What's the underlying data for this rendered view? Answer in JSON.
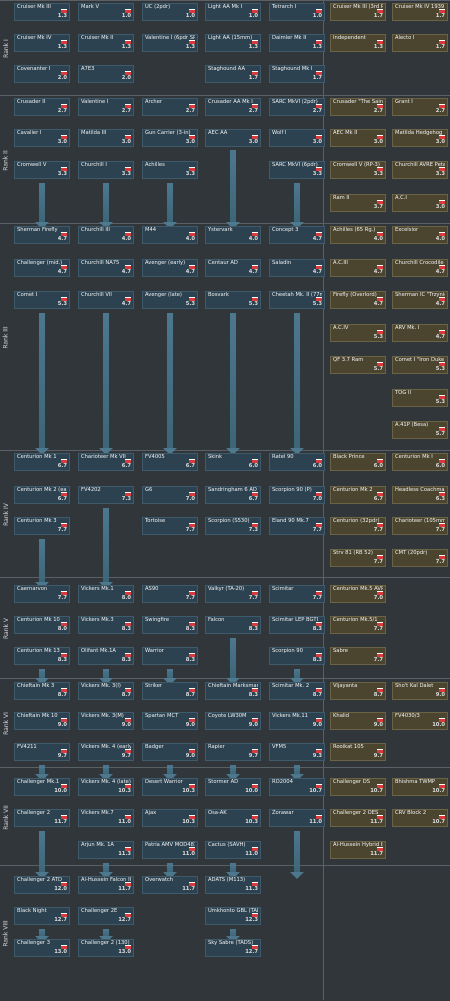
{
  "ranks": [
    {
      "label": "Rank I"
    },
    {
      "label": "Rank II"
    },
    {
      "label": "Rank III"
    },
    {
      "label": "Rank IV"
    },
    {
      "label": "Rank V"
    },
    {
      "label": "Rank VI"
    },
    {
      "label": "Rank VII"
    },
    {
      "label": "Rank VIII"
    }
  ],
  "vehicles": [
    {
      "id": "r1a",
      "name": "Cruiser Mk III",
      "br": "1.3"
    },
    {
      "id": "r1b",
      "name": "Mark V",
      "br": "1.0"
    },
    {
      "id": "r1c",
      "name": "UC (2pdr)",
      "br": "1.0"
    },
    {
      "id": "r1d",
      "name": "Light AA Mk I",
      "br": "1.0"
    },
    {
      "id": "r1e",
      "name": "Tetrarch I",
      "br": "1.0"
    },
    {
      "id": "r1f",
      "name": "Cruiser Mk III (3rd R.T.R.)",
      "br": "1.7",
      "premium": true
    },
    {
      "id": "r1g",
      "name": "Cruiser Mk IV 1939",
      "br": "1.7",
      "premium": true
    },
    {
      "id": "r1h",
      "name": "Cruiser Mk IV",
      "br": "1.3"
    },
    {
      "id": "r1i",
      "name": "Cruiser Mk II",
      "br": "1.3"
    },
    {
      "id": "r1j",
      "name": "Valentine I (6pdr SP)",
      "br": "1.3"
    },
    {
      "id": "r1k",
      "name": "Light AA (15mm)",
      "br": "1.3"
    },
    {
      "id": "r1l",
      "name": "Daimler Mk II",
      "br": "1.3"
    },
    {
      "id": "r1m",
      "name": "Independent",
      "br": "1.3",
      "premium": true
    },
    {
      "id": "r1n",
      "name": "Alecto I",
      "br": "1.7",
      "premium": true
    },
    {
      "id": "r1o",
      "name": "Covenanter I",
      "br": "2.0"
    },
    {
      "id": "r1p",
      "name": "A7E3",
      "br": "2.0"
    },
    {
      "id": "r1q",
      "name": "Staghound AA",
      "br": "1.7"
    },
    {
      "id": "r1r",
      "name": "Staghound Mk I",
      "br": "1.7"
    },
    {
      "id": "r2a",
      "name": "Crusader II",
      "br": "2.7"
    },
    {
      "id": "r2b",
      "name": "Valentine I",
      "br": "2.7"
    },
    {
      "id": "r2c",
      "name": "Archer",
      "br": "2.7"
    },
    {
      "id": "r2d",
      "name": "Crusader AA Mk I",
      "br": "2.7"
    },
    {
      "id": "r2e",
      "name": "SARC MkVI (2pdr)",
      "br": "2.7"
    },
    {
      "id": "r2f",
      "name": "Crusader \"The Saint\"",
      "br": "2.7",
      "premium": true
    },
    {
      "id": "r2g",
      "name": "Grant I",
      "br": "2.7",
      "premium": true
    },
    {
      "id": "r2h",
      "name": "Cavalier I",
      "br": "3.0"
    },
    {
      "id": "r2i",
      "name": "Matilda III",
      "br": "3.0"
    },
    {
      "id": "r2j",
      "name": "Gun Carrier (3-in)",
      "br": "3.0"
    },
    {
      "id": "r2k",
      "name": "AEC AA",
      "br": "3.0"
    },
    {
      "id": "r2l",
      "name": "Wolf I",
      "br": "3.0"
    },
    {
      "id": "r2m",
      "name": "AEC Mk II",
      "br": "3.0",
      "premium": true
    },
    {
      "id": "r2n",
      "name": "Matilda Hedgehog",
      "br": "3.0",
      "premium": true
    },
    {
      "id": "r2o",
      "name": "Cromwell V",
      "br": "3.3"
    },
    {
      "id": "r2p",
      "name": "Churchill I",
      "br": "3.3"
    },
    {
      "id": "r2q",
      "name": "Achilles",
      "br": "3.3"
    },
    {
      "id": "r2r",
      "name": "SARC MkVI (6pdr)",
      "br": "3.3"
    },
    {
      "id": "r2s",
      "name": "Cromwell V (RP-3)",
      "br": "3.3",
      "premium": true
    },
    {
      "id": "r2t",
      "name": "Churchill AVRE Petard",
      "br": "3.3",
      "premium": true
    },
    {
      "id": "r2u",
      "name": "Ram II",
      "br": "3.7",
      "premium": true
    },
    {
      "id": "r2v",
      "name": "A.C.I",
      "br": "3.0",
      "premium": true
    },
    {
      "id": "r3a",
      "name": "Sherman Firefly",
      "br": "4.7"
    },
    {
      "id": "r3b",
      "name": "Churchill III",
      "br": "4.0"
    },
    {
      "id": "r3c",
      "name": "M44",
      "br": "4.0"
    },
    {
      "id": "r3d",
      "name": "Ystervark",
      "br": "4.0"
    },
    {
      "id": "r3e",
      "name": "Concept 3",
      "br": "4.7"
    },
    {
      "id": "r3f",
      "name": "Achilles (65 Rg.)",
      "br": "4.0",
      "premium": true
    },
    {
      "id": "r3g",
      "name": "Excelsior",
      "br": "4.0",
      "premium": true
    },
    {
      "id": "r3h",
      "name": "Challenger (mid.)",
      "br": "4.7"
    },
    {
      "id": "r3i",
      "name": "Churchill NA75",
      "br": "4.7"
    },
    {
      "id": "r3j",
      "name": "Avenger (early)",
      "br": "4.7"
    },
    {
      "id": "r3k",
      "name": "Centaur AD",
      "br": "4.7"
    },
    {
      "id": "r3l",
      "name": "Saladin",
      "br": "4.7"
    },
    {
      "id": "r3m",
      "name": "A.C.III",
      "br": "4.7",
      "premium": true
    },
    {
      "id": "r3n",
      "name": "Churchill Crocodile",
      "br": "4.7",
      "premium": true
    },
    {
      "id": "r3o",
      "name": "Comet I",
      "br": "5.3"
    },
    {
      "id": "r3p",
      "name": "Churchill VII",
      "br": "4.7"
    },
    {
      "id": "r3q",
      "name": "Avenger (late)",
      "br": "5.3"
    },
    {
      "id": "r3r",
      "name": "Bosvark",
      "br": "5.3"
    },
    {
      "id": "r3s",
      "name": "Cheetah Mk. II (77mm)",
      "br": "5.3"
    },
    {
      "id": "r3t",
      "name": "Firefly (Overlord)",
      "br": "4.7",
      "premium": true
    },
    {
      "id": "r3u",
      "name": "Sherman IC \"Trzyniec\"",
      "br": "4.7",
      "premium": true
    },
    {
      "id": "r3v",
      "name": "A.C.IV",
      "br": "5.3",
      "premium": true
    },
    {
      "id": "r3w",
      "name": "ARV Mk. I",
      "br": "4.7",
      "premium": true
    },
    {
      "id": "r3x",
      "name": "QF 3.7 Ram",
      "br": "5.7",
      "premium": true
    },
    {
      "id": "r3y",
      "name": "Comet I \"Iron Duke IV\"",
      "br": "5.3",
      "premium": true
    },
    {
      "id": "r3z",
      "name": "TOG II",
      "br": "5.3",
      "premium": true
    },
    {
      "id": "r3za",
      "name": "A.41P (Besa)",
      "br": "5.7",
      "premium": true
    },
    {
      "id": "r4a",
      "name": "Centurion Mk 1",
      "br": "6.7"
    },
    {
      "id": "r4b",
      "name": "Charioteer Mk VII",
      "br": "6.7"
    },
    {
      "id": "r4c",
      "name": "FV4005",
      "br": "6.7"
    },
    {
      "id": "r4d",
      "name": "Skink",
      "br": "6.0"
    },
    {
      "id": "r4e",
      "name": "Ratel 90",
      "br": "6.0"
    },
    {
      "id": "r4f",
      "name": "Black Prince",
      "br": "6.0",
      "premium": true
    },
    {
      "id": "r4g",
      "name": "Centurion Mk I",
      "br": "6.0",
      "premium": true
    },
    {
      "id": "r4h",
      "name": "Centurion Mk 2 (early)",
      "br": "6.7"
    },
    {
      "id": "r4i",
      "name": "FV4202",
      "br": "7.3"
    },
    {
      "id": "r4j",
      "name": "G6",
      "br": "7.0"
    },
    {
      "id": "r4k",
      "name": "Sandringham 6 AD",
      "br": "6.7"
    },
    {
      "id": "r4l",
      "name": "Scorpion 90 (P)",
      "br": "7.0"
    },
    {
      "id": "r4m",
      "name": "Centurion Mk 2",
      "br": "6.7",
      "premium": true
    },
    {
      "id": "r4n",
      "name": "Headless Coachman",
      "br": "6.3",
      "premium": true
    },
    {
      "id": "r4o",
      "name": "Centurion Mk 3",
      "br": "7.7"
    },
    {
      "id": "r4p",
      "name": "Tortoise",
      "br": "7.7"
    },
    {
      "id": "r4q",
      "name": "Scorpion (S530)",
      "br": "7.3"
    },
    {
      "id": "r4r",
      "name": "Eland 90 Mk.7",
      "br": "7.7"
    },
    {
      "id": "r4s",
      "name": "Centurion (32pdr)",
      "br": "7.7",
      "premium": true
    },
    {
      "id": "r4t",
      "name": "Charioteer (105mm)",
      "br": "7.7",
      "premium": true
    },
    {
      "id": "r4u",
      "name": "Strv 81 (RB 52)",
      "br": "7.7",
      "premium": true
    },
    {
      "id": "r4v",
      "name": "CMT (20pdr)",
      "br": "7.7",
      "premium": true
    },
    {
      "id": "r5a",
      "name": "Caernarvon",
      "br": "7.7"
    },
    {
      "id": "r5b",
      "name": "Vickers Mk.1",
      "br": "8.0"
    },
    {
      "id": "r5c",
      "name": "AS90",
      "br": "7.7"
    },
    {
      "id": "r5d",
      "name": "Valkyr (TA-20)",
      "br": "7.7"
    },
    {
      "id": "r5e",
      "name": "Scimitar",
      "br": "7.7"
    },
    {
      "id": "r5f",
      "name": "Centurion Mk.5 AVRE",
      "br": "7.0",
      "premium": true
    },
    {
      "id": "r5g",
      "name": "Centurion Mk 10",
      "br": "8.0"
    },
    {
      "id": "r5h",
      "name": "Vickers Mk.3",
      "br": "8.3"
    },
    {
      "id": "r5i",
      "name": "Swingfire",
      "br": "8.3"
    },
    {
      "id": "r5j",
      "name": "Falcon",
      "br": "8.3"
    },
    {
      "id": "r5k",
      "name": "Scimitar LEP BGTI",
      "br": "8.3"
    },
    {
      "id": "r5l",
      "name": "Centurion Mk.5/1",
      "br": "7.7",
      "premium": true
    },
    {
      "id": "r5m",
      "name": "Centurion Mk 13",
      "br": "8.3"
    },
    {
      "id": "r5n",
      "name": "Olifant Mk.1A",
      "br": "8.3"
    },
    {
      "id": "r5o",
      "name": "Warrior",
      "br": "8.3"
    },
    {
      "id": "r5p",
      "name": "Scorpion 90",
      "br": "8.3"
    },
    {
      "id": "r5q",
      "name": "Sabre",
      "br": "7.7",
      "premium": true
    },
    {
      "id": "r6a",
      "name": "Chieftain Mk 3",
      "br": "8.7"
    },
    {
      "id": "r6b",
      "name": "Vickers Mk. 3(I)",
      "br": "8.7"
    },
    {
      "id": "r6c",
      "name": "Striker",
      "br": "8.7"
    },
    {
      "id": "r6d",
      "name": "Chieftain Marksman",
      "br": "8.3"
    },
    {
      "id": "r6e",
      "name": "Scimitar Mk. 2",
      "br": "8.7"
    },
    {
      "id": "r6f",
      "name": "Vijayanta",
      "br": "8.7",
      "premium": true
    },
    {
      "id": "r6g",
      "name": "Sho't Kal Dalet",
      "br": "9.0",
      "premium": true
    },
    {
      "id": "r6h",
      "name": "Chieftain Mk 10",
      "br": "9.0"
    },
    {
      "id": "r6i",
      "name": "Vickers Mk. 3(M)",
      "br": "9.0"
    },
    {
      "id": "r6j",
      "name": "Spartan MCT",
      "br": "9.0"
    },
    {
      "id": "r6k",
      "name": "Coyote LW30M",
      "br": "9.0"
    },
    {
      "id": "r6l",
      "name": "Vickers Mk.11",
      "br": "9.0"
    },
    {
      "id": "r6m",
      "name": "Khalid",
      "br": "9.0",
      "premium": true
    },
    {
      "id": "r6n",
      "name": "FV4030/3",
      "br": "10.0",
      "premium": true
    },
    {
      "id": "r6o",
      "name": "FV4211",
      "br": "9.7"
    },
    {
      "id": "r6p",
      "name": "Vickers Mk. 4 (early)",
      "br": "9.7"
    },
    {
      "id": "r6q",
      "name": "Badger",
      "br": "9.0"
    },
    {
      "id": "r6r",
      "name": "Rapier",
      "br": "9.7"
    },
    {
      "id": "r6s",
      "name": "VFM5",
      "br": "9.3"
    },
    {
      "id": "r6t",
      "name": "Rooikat 105",
      "br": "9.7",
      "premium": true
    },
    {
      "id": "r7a",
      "name": "Challenger Mk.1",
      "br": "10.0"
    },
    {
      "id": "r7b",
      "name": "Vickers Mk. 4 (late)",
      "br": "10.3"
    },
    {
      "id": "r7c",
      "name": "Desert Warrior",
      "br": "10.3"
    },
    {
      "id": "r7d",
      "name": "Stormer AD",
      "br": "10.0"
    },
    {
      "id": "r7e",
      "name": "RO2004",
      "br": "10.7"
    },
    {
      "id": "r7f",
      "name": "Challenger DS",
      "br": "10.7",
      "premium": true
    },
    {
      "id": "r7g",
      "name": "Bhishma TWMP",
      "br": "10.7",
      "premium": true
    },
    {
      "id": "r7h",
      "name": "Challenger 2",
      "br": "11.7"
    },
    {
      "id": "r7i",
      "name": "Vickers Mk.7",
      "br": "11.0"
    },
    {
      "id": "r7j",
      "name": "Ajax",
      "br": "10.3"
    },
    {
      "id": "r7k",
      "name": "Osa-AK",
      "br": "10.3"
    },
    {
      "id": "r7l",
      "name": "Zorawar",
      "br": "11.0"
    },
    {
      "id": "r7m",
      "name": "Challenger 2 OES",
      "br": "11.7",
      "premium": true
    },
    {
      "id": "r7n",
      "name": "CRV Block 2",
      "br": "10.7",
      "premium": true
    },
    {
      "id": "r7o",
      "name": "Arjun Mk. 1A",
      "br": "11.3"
    },
    {
      "id": "r7p",
      "name": "Patria AMV MOD481",
      "br": "11.0"
    },
    {
      "id": "r7q",
      "name": "Cactus (SAVH)",
      "br": "11.0"
    },
    {
      "id": "r7r",
      "name": "Al-Hussein Hybrid II",
      "br": "11.7",
      "premium": true
    },
    {
      "id": "r8a",
      "name": "Challenger 2 ATD",
      "br": "12.0"
    },
    {
      "id": "r8b",
      "name": "Al-Hussein Falcon II",
      "br": "11.7"
    },
    {
      "id": "r8c",
      "name": "Overwatch",
      "br": "11.7"
    },
    {
      "id": "r8d",
      "name": "ADATS (M113)",
      "br": "11.3"
    },
    {
      "id": "r8e",
      "name": "Black Night",
      "br": "12.7"
    },
    {
      "id": "r8f",
      "name": "Challenger 2E",
      "br": "12.7"
    },
    {
      "id": "r8g",
      "name": "Umkhonto GBL (TADS)",
      "br": "12.3"
    },
    {
      "id": "r8h",
      "name": "Challenger 3",
      "br": "13.0"
    },
    {
      "id": "r8i",
      "name": "Challenger 2 (130)",
      "br": "13.0"
    },
    {
      "id": "r8j",
      "name": "Sky Sabre (TADS)",
      "br": "12.7"
    }
  ]
}
